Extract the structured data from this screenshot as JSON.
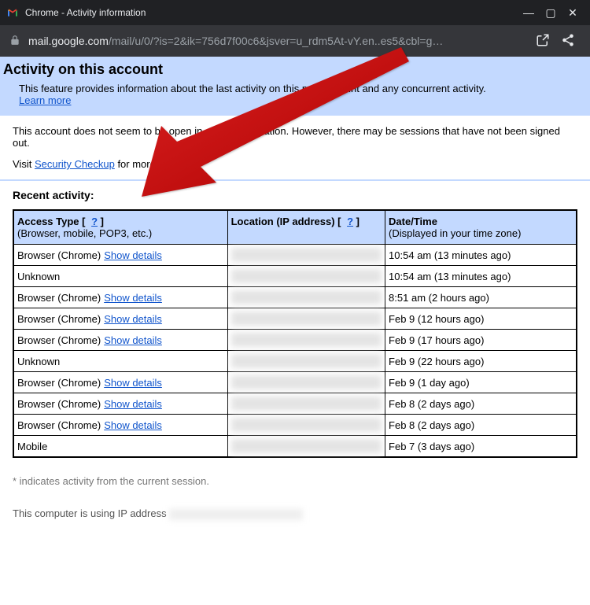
{
  "titlebar": {
    "title": "Chrome - Activity information"
  },
  "urlbar": {
    "host": "mail.google.com",
    "path": "/mail/u/0/?is=2&ik=756d7f00c6&jsver=u_rdm5At-vY.en..es5&cbl=g…"
  },
  "header": {
    "title": "Activity on this account",
    "desc": "This feature provides information about the last activity on this mail account and any concurrent activity.",
    "learn_more": "Learn more"
  },
  "body": {
    "session_note": "This account does not seem to be open in any other location. However, there may be sessions that have not been signed out.",
    "visit_prefix": "Visit ",
    "security_checkup": "Security Checkup",
    "visit_suffix": " for more details",
    "recent_activity": "Recent activity:",
    "footnote": "* indicates activity from the current session.",
    "ip_line_prefix": "This computer is using IP address "
  },
  "table": {
    "headers": {
      "access_type": "Access Type",
      "access_sub": "(Browser, mobile, POP3, etc.)",
      "location": "Location (IP address)",
      "datetime": "Date/Time",
      "datetime_sub": "(Displayed in your time zone)",
      "help": "?"
    },
    "show_details": "Show details",
    "rows": [
      {
        "type": "Browser (Chrome)",
        "details": true,
        "dt": "10:54 am (13 minutes ago)"
      },
      {
        "type": "Unknown",
        "details": false,
        "dt": "10:54 am (13 minutes ago)"
      },
      {
        "type": "Browser (Chrome)",
        "details": true,
        "dt": "8:51 am (2 hours ago)"
      },
      {
        "type": "Browser (Chrome)",
        "details": true,
        "dt": "Feb 9 (12 hours ago)"
      },
      {
        "type": "Browser (Chrome)",
        "details": true,
        "dt": "Feb 9 (17 hours ago)"
      },
      {
        "type": "Unknown",
        "details": false,
        "dt": "Feb 9 (22 hours ago)"
      },
      {
        "type": "Browser (Chrome)",
        "details": true,
        "dt": "Feb 9 (1 day ago)"
      },
      {
        "type": "Browser (Chrome)",
        "details": true,
        "dt": "Feb 8 (2 days ago)"
      },
      {
        "type": "Browser (Chrome)",
        "details": true,
        "dt": "Feb 8 (2 days ago)"
      },
      {
        "type": "Mobile",
        "details": false,
        "dt": "Feb 7 (3 days ago)"
      }
    ]
  }
}
